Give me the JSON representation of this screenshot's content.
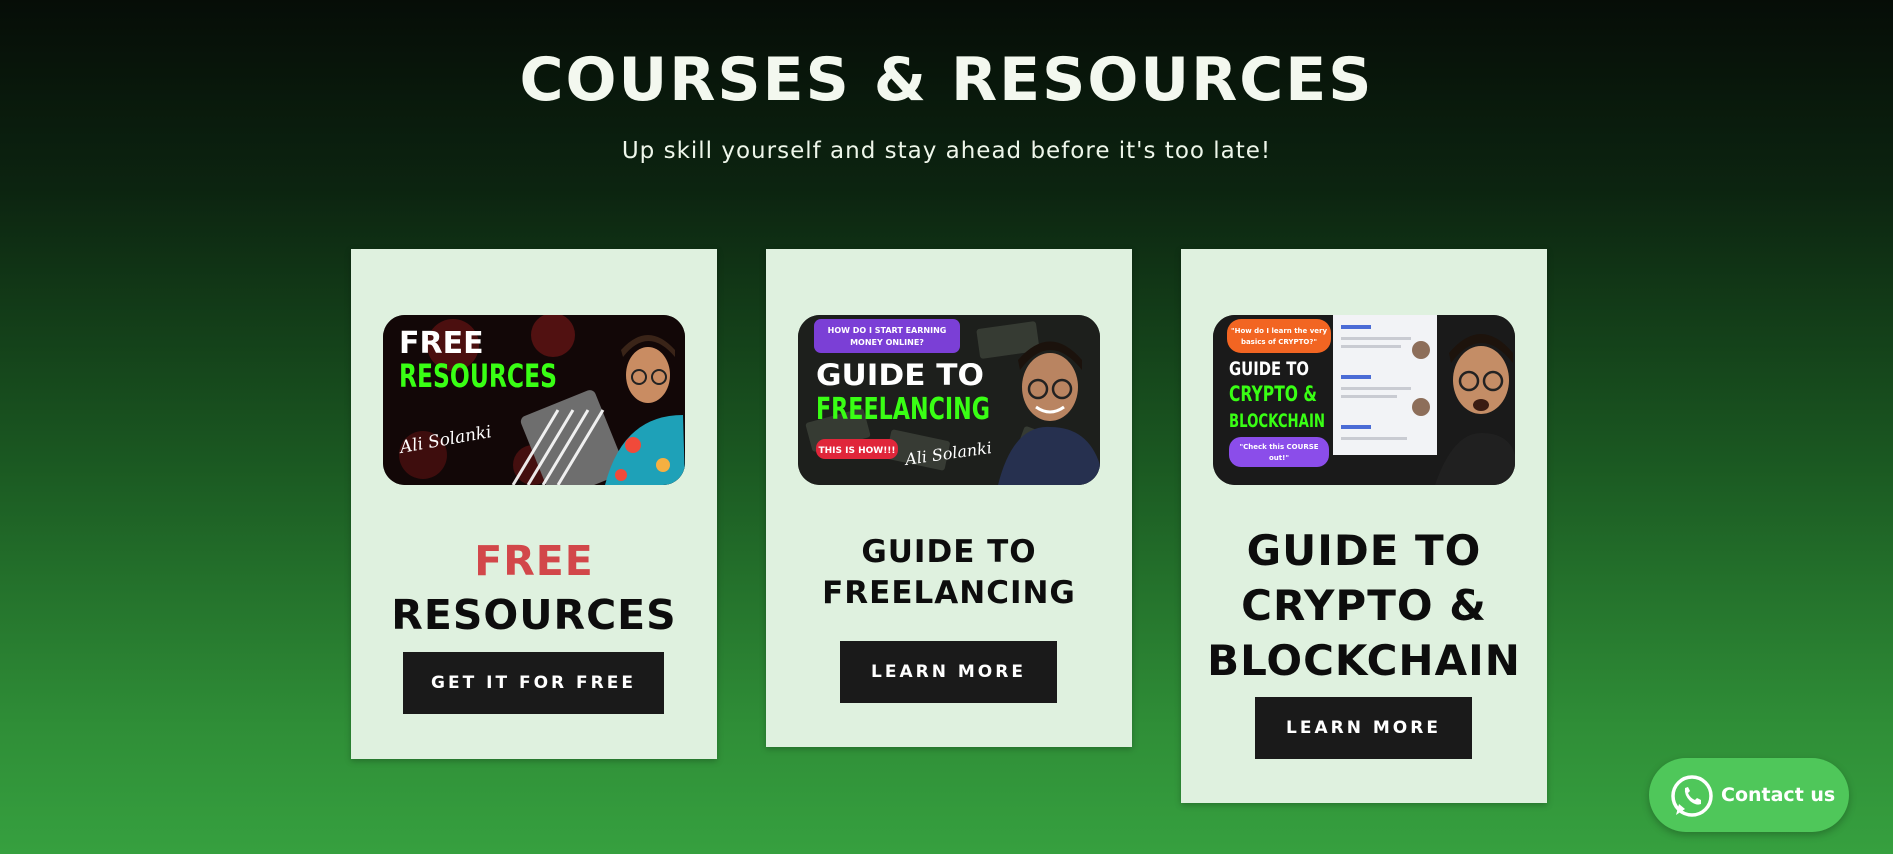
{
  "section": {
    "title": "COURSES & RESOURCES",
    "subtitle": "Up skill yourself and stay ahead before it's too late!"
  },
  "cards": [
    {
      "thumbnail": {
        "line1": "FREE",
        "line2": "RESOURCES",
        "signature": "Ali Solanki"
      },
      "title_accent": "FREE",
      "title_rest": "RESOURCES",
      "button": "GET IT FOR FREE"
    },
    {
      "thumbnail": {
        "badge": "HOW DO I START EARNING MONEY ONLINE?",
        "line1": "GUIDE TO",
        "line2": "FREELANCING",
        "tag": "THIS IS HOW!!!",
        "signature": "Ali Solanki"
      },
      "title": "GUIDE TO FREELANCING",
      "button": "LEARN MORE"
    },
    {
      "thumbnail": {
        "badge": "\"How do I learn the very basics of CRYPTO?\"",
        "line1": "GUIDE TO",
        "line2": "CRYPTO &",
        "line3": "BLOCKCHAIN",
        "tag": "\"Check this COURSE out!\""
      },
      "title": "GUIDE TO CRYPTO & BLOCKCHAIN",
      "button": "LEARN MORE"
    }
  ],
  "contact": {
    "label": "Contact us",
    "icon": "whatsapp-icon"
  },
  "colors": {
    "card_bg": "#dff1df",
    "accent_red": "#d2474a",
    "button_bg": "#1a1a1a",
    "thumb_green": "#39ff14",
    "whatsapp_green": "#4fc75a"
  }
}
